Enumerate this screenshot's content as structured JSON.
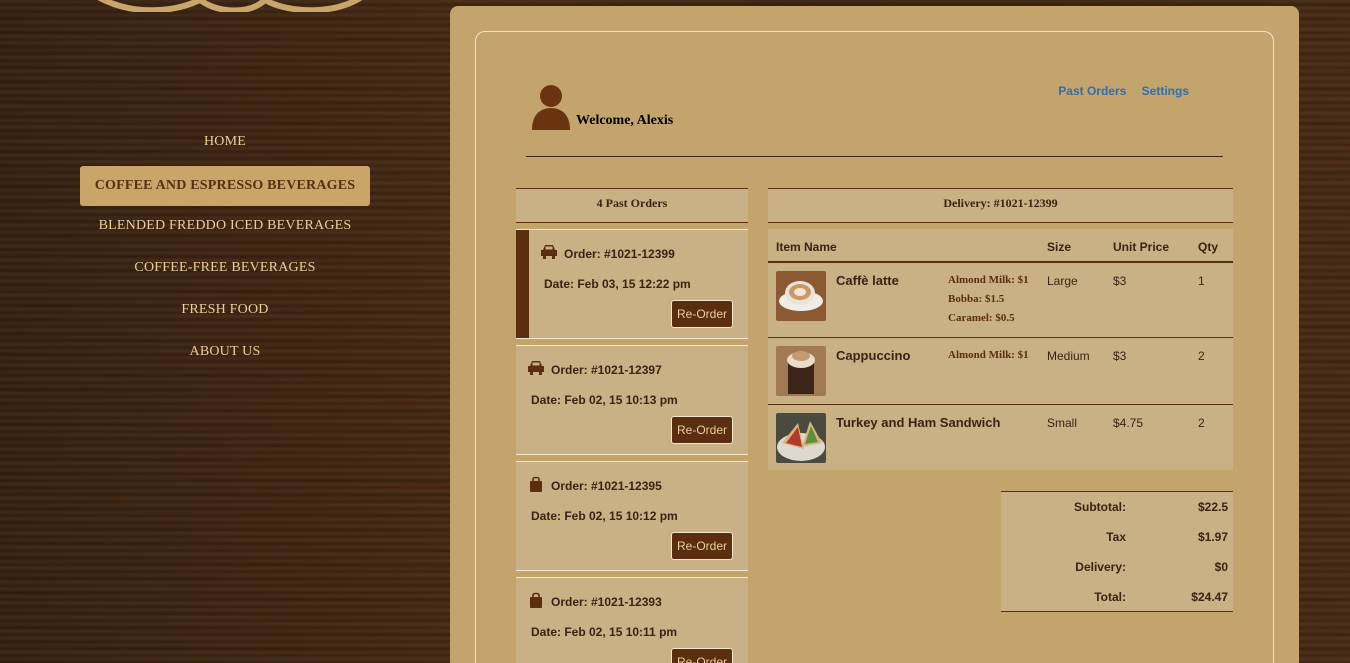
{
  "nav": {
    "items": [
      {
        "label": "HOME"
      },
      {
        "label": "COFFEE AND ESPRESSO BEVERAGES"
      },
      {
        "label": "BLENDED FREDDO ICED BEVERAGES"
      },
      {
        "label": "COFFEE-FREE BEVERAGES"
      },
      {
        "label": "FRESH FOOD"
      },
      {
        "label": "ABOUT US"
      }
    ],
    "active": "COFFEE AND ESPRESSO BEVERAGES"
  },
  "header": {
    "welcome": "Welcome, Alexis",
    "links": {
      "past_orders": "Past Orders",
      "settings": "Settings"
    }
  },
  "orders": {
    "title": "4 Past Orders",
    "list": [
      {
        "id": "Order: #1021-12399",
        "date": "Date: Feb 03, 15 12:22 pm",
        "type_icon": "car-icon",
        "action": "Re-Order",
        "selected": true
      },
      {
        "id": "Order: #1021-12397",
        "date": "Date: Feb 02, 15 10:13 pm",
        "type_icon": "car-icon",
        "action": "Re-Order"
      },
      {
        "id": "Order: #1021-12395",
        "date": "Date: Feb 02, 15 10:12 pm",
        "type_icon": "bag-icon",
        "action": "Re-Order"
      },
      {
        "id": "Order: #1021-12393",
        "date": "Date: Feb 02, 15 10:11 pm",
        "type_icon": "bag-icon",
        "action": "Re-Order"
      }
    ]
  },
  "detail": {
    "title": "Delivery: #1021-12399",
    "columns": {
      "item": "Item Name",
      "size": "Size",
      "price": "Unit Price",
      "qty": "Qty"
    },
    "items": [
      {
        "name": "Caffè latte",
        "addons": [
          "Almond Milk: $1",
          "Bobba: $1.5",
          "Caramel: $0.5"
        ],
        "size": "Large",
        "price": "$3",
        "qty": "1"
      },
      {
        "name": "Cappuccino",
        "addons": [
          "Almond Milk: $1"
        ],
        "size": "Medium",
        "price": "$3",
        "qty": "2"
      },
      {
        "name": "Turkey and Ham Sandwich",
        "addons": [],
        "size": "Small",
        "price": "$4.75",
        "qty": "2"
      }
    ],
    "totals": {
      "subtotal_label": "Subtotal:",
      "subtotal": "$22.5",
      "tax_label": "Tax",
      "tax": "$1.97",
      "delivery_label": "Delivery:",
      "delivery": "$0",
      "total_label": "Total:",
      "total": "$24.47"
    }
  },
  "colors": {
    "accent_dark": "#5a2e0e",
    "panel": "#c4a46d",
    "link": "#2a6fb5"
  }
}
